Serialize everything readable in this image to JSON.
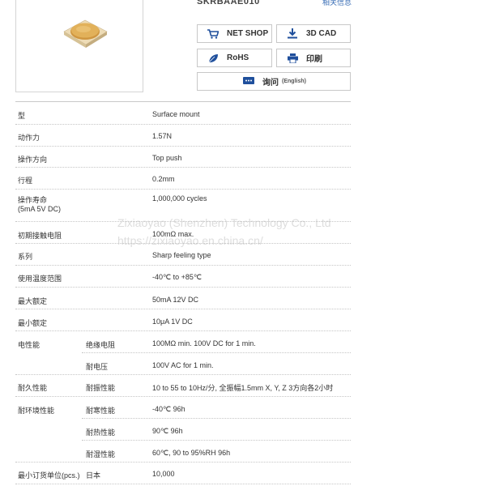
{
  "product": {
    "code": "SKRBAAE010",
    "related_link": "相关信息"
  },
  "buttons": {
    "net_shop": "NET SHOP",
    "cad": "3D CAD",
    "rohs": "RoHS",
    "print": "印刷",
    "inquiry": "询问",
    "inquiry_lang": "(English)"
  },
  "specs": [
    {
      "label": "型",
      "sub": "",
      "value": "Surface mount"
    },
    {
      "label": "动作力",
      "sub": "",
      "value": "1.57N"
    },
    {
      "label": "操作方向",
      "sub": "",
      "value": "Top push"
    },
    {
      "label": "行程",
      "sub": "",
      "value": "0.2mm"
    },
    {
      "label": "操作寿命",
      "label2": "(5mA 5V DC)",
      "sub": "",
      "value": "1,000,000 cycles"
    },
    {
      "label": "初期接触电阻",
      "sub": "",
      "value": "100mΩ max."
    },
    {
      "label": "系列",
      "sub": "",
      "value": "Sharp feeling type"
    },
    {
      "label": "使用温度范围",
      "sub": "",
      "value": "-40℃ to +85℃"
    },
    {
      "label": "最大额定",
      "sub": "",
      "value": "50mA 12V DC"
    },
    {
      "label": "最小额定",
      "sub": "",
      "value": "10μA 1V DC"
    },
    {
      "label": "电性能",
      "sub": "绝缘电阻",
      "value": "100MΩ min. 100V DC for 1 min."
    },
    {
      "label": "",
      "sub": "耐电压",
      "value": "100V AC for 1 min."
    },
    {
      "label": "耐久性能",
      "sub": "耐振性能",
      "value": "10 to 55 to 10Hz/分, 全振幅1.5mm X, Y, Z 3方向各2小时"
    },
    {
      "label": "耐环境性能",
      "sub": "耐寒性能",
      "value": "-40℃ 96h"
    },
    {
      "label": "",
      "sub": "耐热性能",
      "value": "90℃ 96h"
    },
    {
      "label": "",
      "sub": "耐湿性能",
      "value": "60℃, 90 to 95%RH 96h"
    },
    {
      "label": "最小订货单位(pcs.)",
      "sub": "日本",
      "value": "10,000"
    }
  ],
  "watermark": {
    "line1": "Zixiaoyao (Shenzhen) Technology Co., Ltd",
    "line2": "https://zixiaoyao.en.china.cn/"
  },
  "colors": {
    "accent": "#1f4f9c",
    "border": "#c8c8c8"
  },
  "icons": {
    "net_shop": "cart-icon",
    "cad": "download-icon",
    "rohs": "leaf-icon",
    "print": "printer-icon",
    "inquiry": "chat-icon"
  }
}
